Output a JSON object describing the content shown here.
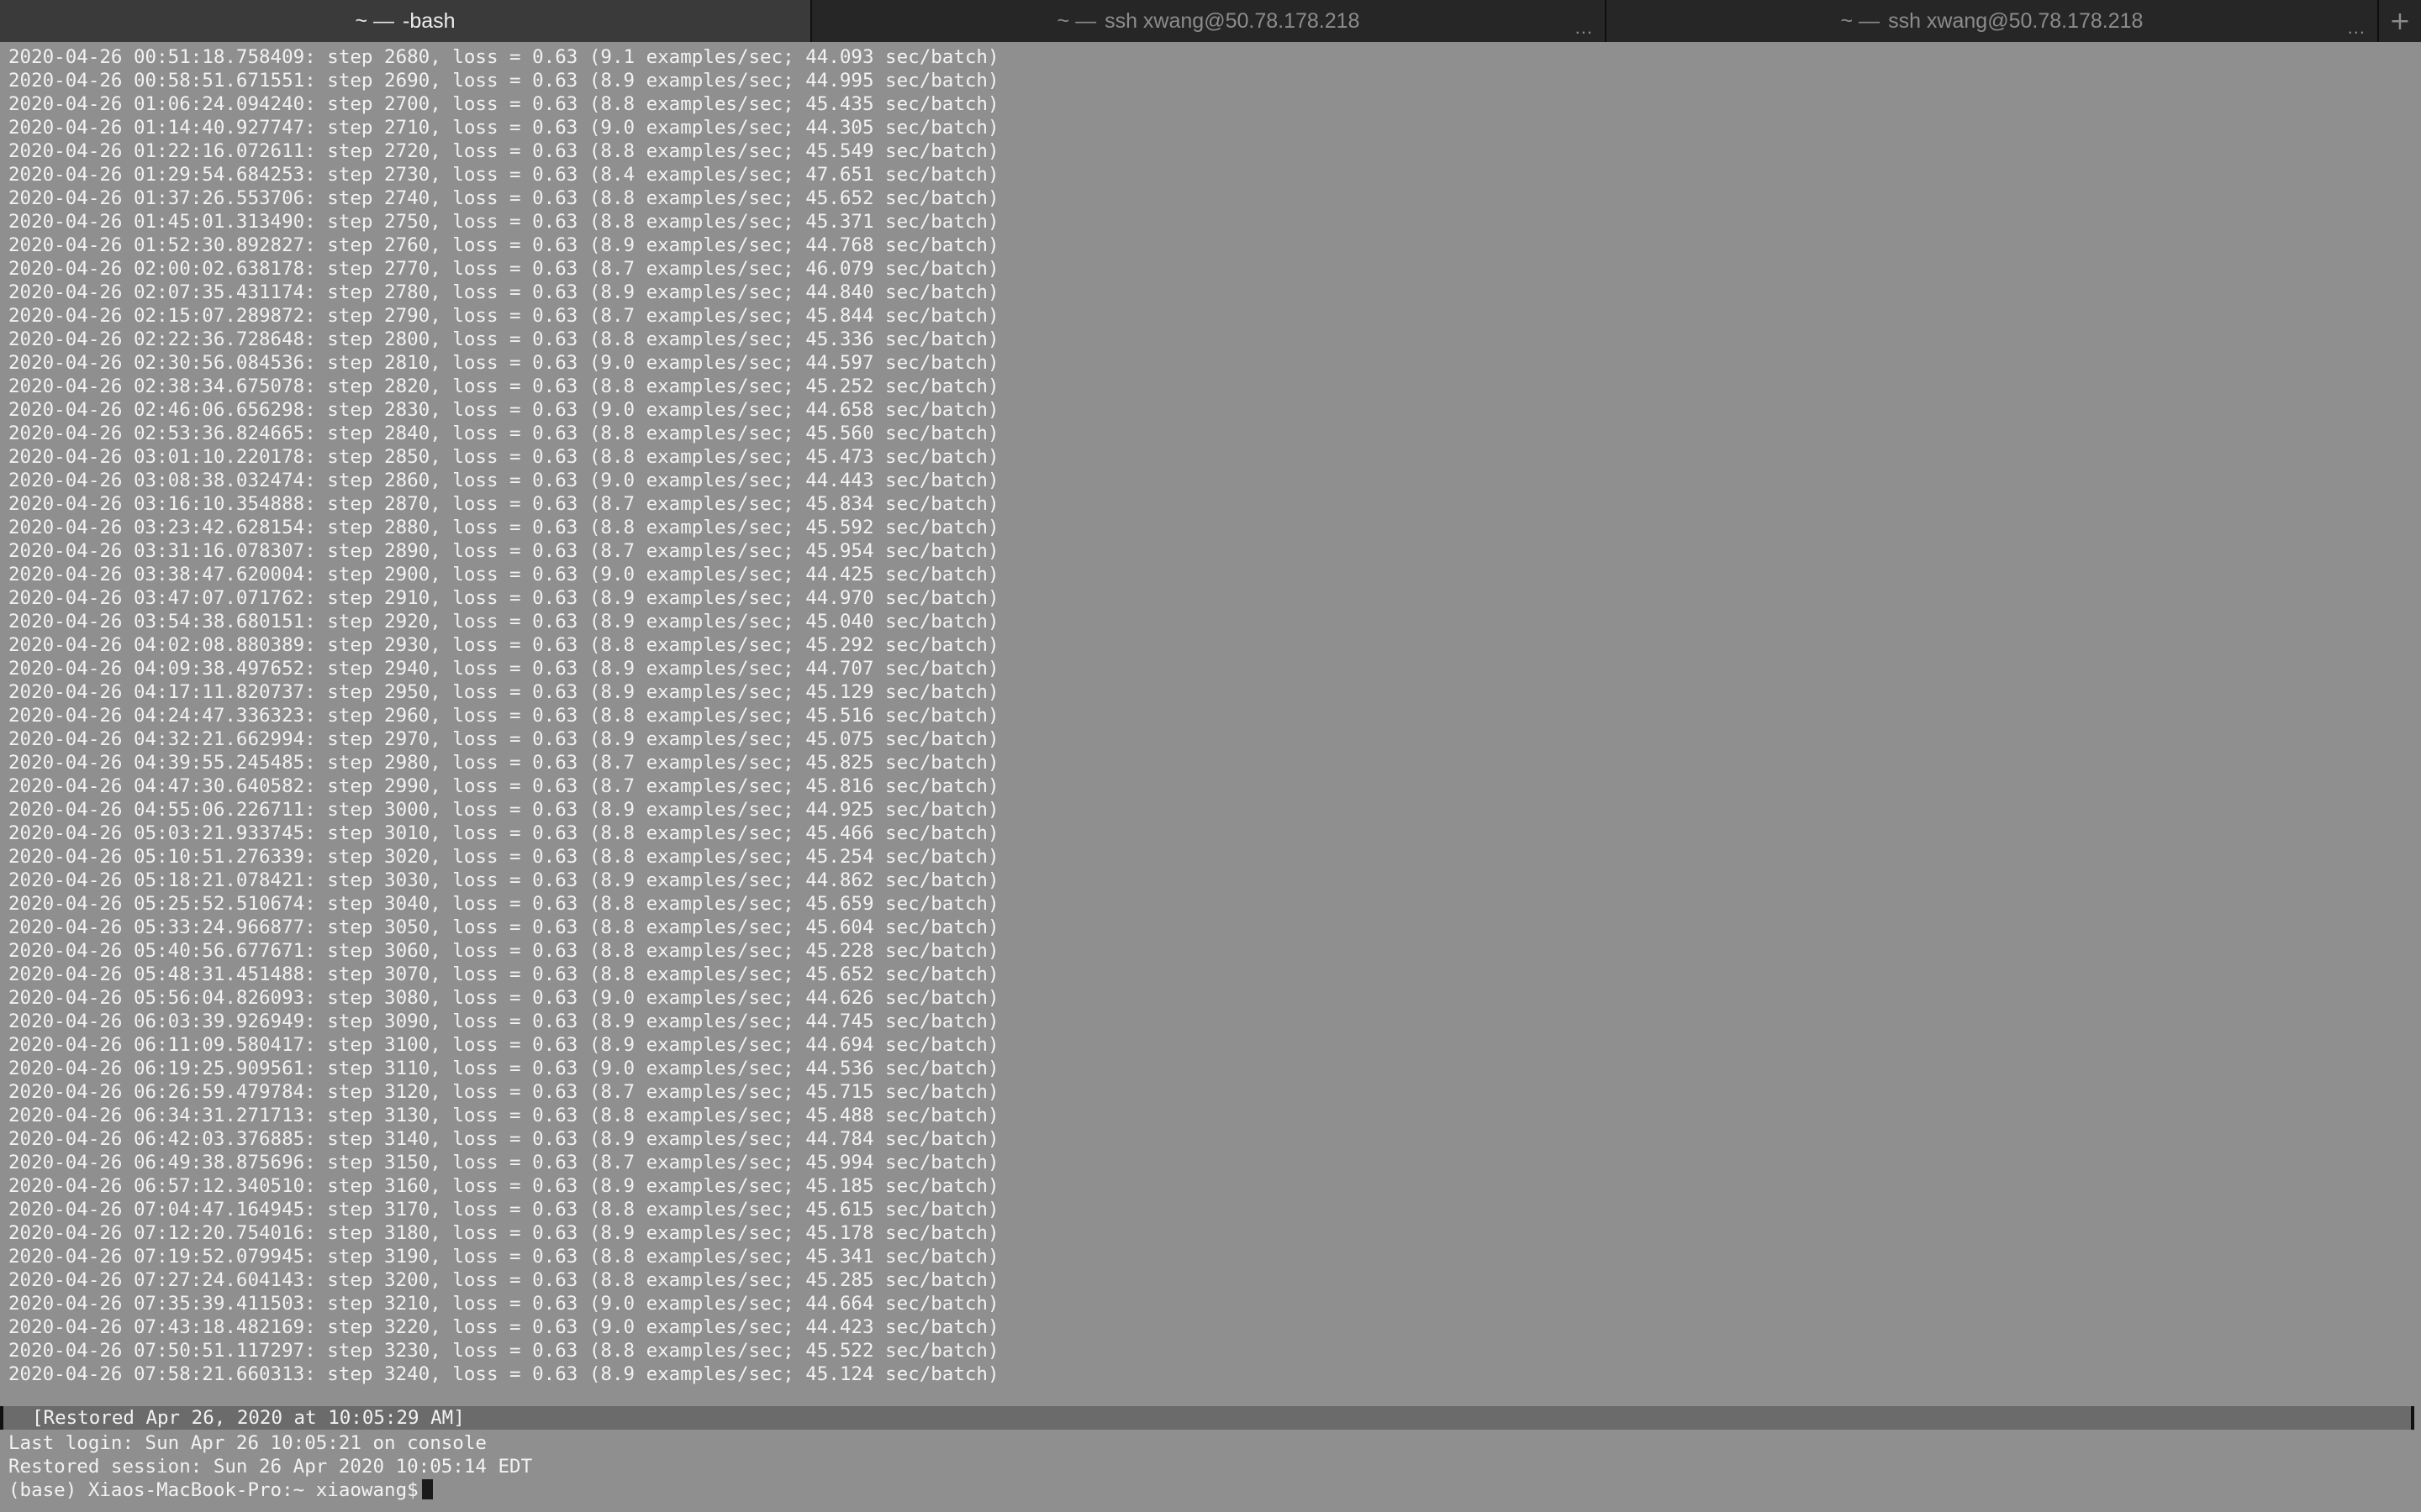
{
  "tabs": [
    {
      "prefix": "~ —",
      "title": "-bash",
      "active": true,
      "more": ""
    },
    {
      "prefix": "~ —",
      "title": "ssh xwang@50.78.178.218",
      "active": false,
      "more": "..."
    },
    {
      "prefix": "~ —",
      "title": "ssh xwang@50.78.178.218",
      "active": false,
      "more": "..."
    }
  ],
  "add_tab_glyph": "+",
  "log_lines": [
    "2020-04-26 00:51:18.758409: step 2680, loss = 0.63 (9.1 examples/sec; 44.093 sec/batch)",
    "2020-04-26 00:58:51.671551: step 2690, loss = 0.63 (8.9 examples/sec; 44.995 sec/batch)",
    "2020-04-26 01:06:24.094240: step 2700, loss = 0.63 (8.8 examples/sec; 45.435 sec/batch)",
    "2020-04-26 01:14:40.927747: step 2710, loss = 0.63 (9.0 examples/sec; 44.305 sec/batch)",
    "2020-04-26 01:22:16.072611: step 2720, loss = 0.63 (8.8 examples/sec; 45.549 sec/batch)",
    "2020-04-26 01:29:54.684253: step 2730, loss = 0.63 (8.4 examples/sec; 47.651 sec/batch)",
    "2020-04-26 01:37:26.553706: step 2740, loss = 0.63 (8.8 examples/sec; 45.652 sec/batch)",
    "2020-04-26 01:45:01.313490: step 2750, loss = 0.63 (8.8 examples/sec; 45.371 sec/batch)",
    "2020-04-26 01:52:30.892827: step 2760, loss = 0.63 (8.9 examples/sec; 44.768 sec/batch)",
    "2020-04-26 02:00:02.638178: step 2770, loss = 0.63 (8.7 examples/sec; 46.079 sec/batch)",
    "2020-04-26 02:07:35.431174: step 2780, loss = 0.63 (8.9 examples/sec; 44.840 sec/batch)",
    "2020-04-26 02:15:07.289872: step 2790, loss = 0.63 (8.7 examples/sec; 45.844 sec/batch)",
    "2020-04-26 02:22:36.728648: step 2800, loss = 0.63 (8.8 examples/sec; 45.336 sec/batch)",
    "2020-04-26 02:30:56.084536: step 2810, loss = 0.63 (9.0 examples/sec; 44.597 sec/batch)",
    "2020-04-26 02:38:34.675078: step 2820, loss = 0.63 (8.8 examples/sec; 45.252 sec/batch)",
    "2020-04-26 02:46:06.656298: step 2830, loss = 0.63 (9.0 examples/sec; 44.658 sec/batch)",
    "2020-04-26 02:53:36.824665: step 2840, loss = 0.63 (8.8 examples/sec; 45.560 sec/batch)",
    "2020-04-26 03:01:10.220178: step 2850, loss = 0.63 (8.8 examples/sec; 45.473 sec/batch)",
    "2020-04-26 03:08:38.032474: step 2860, loss = 0.63 (9.0 examples/sec; 44.443 sec/batch)",
    "2020-04-26 03:16:10.354888: step 2870, loss = 0.63 (8.7 examples/sec; 45.834 sec/batch)",
    "2020-04-26 03:23:42.628154: step 2880, loss = 0.63 (8.8 examples/sec; 45.592 sec/batch)",
    "2020-04-26 03:31:16.078307: step 2890, loss = 0.63 (8.7 examples/sec; 45.954 sec/batch)",
    "2020-04-26 03:38:47.620004: step 2900, loss = 0.63 (9.0 examples/sec; 44.425 sec/batch)",
    "2020-04-26 03:47:07.071762: step 2910, loss = 0.63 (8.9 examples/sec; 44.970 sec/batch)",
    "2020-04-26 03:54:38.680151: step 2920, loss = 0.63 (8.9 examples/sec; 45.040 sec/batch)",
    "2020-04-26 04:02:08.880389: step 2930, loss = 0.63 (8.8 examples/sec; 45.292 sec/batch)",
    "2020-04-26 04:09:38.497652: step 2940, loss = 0.63 (8.9 examples/sec; 44.707 sec/batch)",
    "2020-04-26 04:17:11.820737: step 2950, loss = 0.63 (8.9 examples/sec; 45.129 sec/batch)",
    "2020-04-26 04:24:47.336323: step 2960, loss = 0.63 (8.8 examples/sec; 45.516 sec/batch)",
    "2020-04-26 04:32:21.662994: step 2970, loss = 0.63 (8.9 examples/sec; 45.075 sec/batch)",
    "2020-04-26 04:39:55.245485: step 2980, loss = 0.63 (8.7 examples/sec; 45.825 sec/batch)",
    "2020-04-26 04:47:30.640582: step 2990, loss = 0.63 (8.7 examples/sec; 45.816 sec/batch)",
    "2020-04-26 04:55:06.226711: step 3000, loss = 0.63 (8.9 examples/sec; 44.925 sec/batch)",
    "2020-04-26 05:03:21.933745: step 3010, loss = 0.63 (8.8 examples/sec; 45.466 sec/batch)",
    "2020-04-26 05:10:51.276339: step 3020, loss = 0.63 (8.8 examples/sec; 45.254 sec/batch)",
    "2020-04-26 05:18:21.078421: step 3030, loss = 0.63 (8.9 examples/sec; 44.862 sec/batch)",
    "2020-04-26 05:25:52.510674: step 3040, loss = 0.63 (8.8 examples/sec; 45.659 sec/batch)",
    "2020-04-26 05:33:24.966877: step 3050, loss = 0.63 (8.8 examples/sec; 45.604 sec/batch)",
    "2020-04-26 05:40:56.677671: step 3060, loss = 0.63 (8.8 examples/sec; 45.228 sec/batch)",
    "2020-04-26 05:48:31.451488: step 3070, loss = 0.63 (8.8 examples/sec; 45.652 sec/batch)",
    "2020-04-26 05:56:04.826093: step 3080, loss = 0.63 (9.0 examples/sec; 44.626 sec/batch)",
    "2020-04-26 06:03:39.926949: step 3090, loss = 0.63 (8.9 examples/sec; 44.745 sec/batch)",
    "2020-04-26 06:11:09.580417: step 3100, loss = 0.63 (8.9 examples/sec; 44.694 sec/batch)",
    "2020-04-26 06:19:25.909561: step 3110, loss = 0.63 (9.0 examples/sec; 44.536 sec/batch)",
    "2020-04-26 06:26:59.479784: step 3120, loss = 0.63 (8.7 examples/sec; 45.715 sec/batch)",
    "2020-04-26 06:34:31.271713: step 3130, loss = 0.63 (8.8 examples/sec; 45.488 sec/batch)",
    "2020-04-26 06:42:03.376885: step 3140, loss = 0.63 (8.9 examples/sec; 44.784 sec/batch)",
    "2020-04-26 06:49:38.875696: step 3150, loss = 0.63 (8.7 examples/sec; 45.994 sec/batch)",
    "2020-04-26 06:57:12.340510: step 3160, loss = 0.63 (8.9 examples/sec; 45.185 sec/batch)",
    "2020-04-26 07:04:47.164945: step 3170, loss = 0.63 (8.8 examples/sec; 45.615 sec/batch)",
    "2020-04-26 07:12:20.754016: step 3180, loss = 0.63 (8.9 examples/sec; 45.178 sec/batch)",
    "2020-04-26 07:19:52.079945: step 3190, loss = 0.63 (8.8 examples/sec; 45.341 sec/batch)",
    "2020-04-26 07:27:24.604143: step 3200, loss = 0.63 (8.8 examples/sec; 45.285 sec/batch)",
    "2020-04-26 07:35:39.411503: step 3210, loss = 0.63 (9.0 examples/sec; 44.664 sec/batch)",
    "2020-04-26 07:43:18.482169: step 3220, loss = 0.63 (9.0 examples/sec; 44.423 sec/batch)",
    "2020-04-26 07:50:51.117297: step 3230, loss = 0.63 (8.8 examples/sec; 45.522 sec/batch)",
    "2020-04-26 07:58:21.660313: step 3240, loss = 0.63 (8.9 examples/sec; 45.124 sec/batch)"
  ],
  "restored_banner": "[Restored Apr 26, 2020 at 10:05:29 AM]",
  "last_login": "Last login: Sun Apr 26 10:05:21 on console",
  "restored_session": "Restored session: Sun 26 Apr 2020 10:05:14 EDT",
  "prompt": "(base) Xiaos-MacBook-Pro:~ xiaowang$",
  "colors": {
    "terminal_bg": "#8f8f8f",
    "text": "#f2f2f2",
    "tabbar_bg": "#1e1e1e",
    "active_tab_bg": "#3a3a3a"
  }
}
